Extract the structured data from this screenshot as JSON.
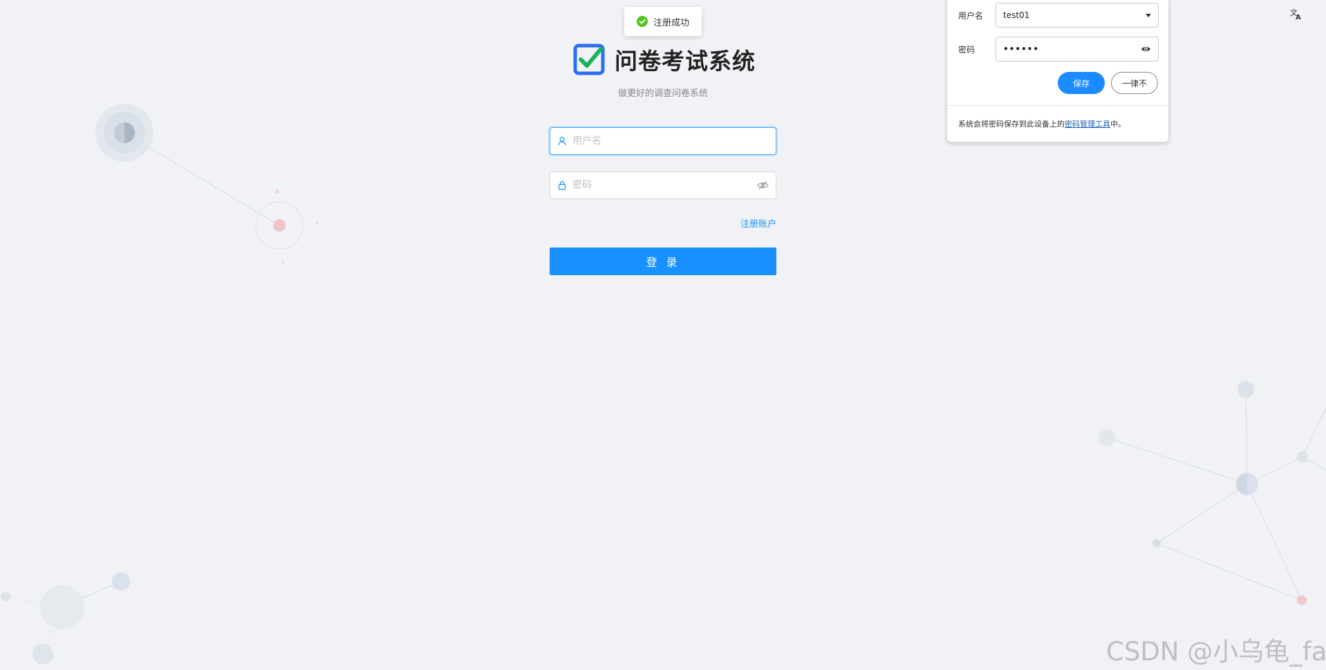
{
  "toast": {
    "text": "注册成功"
  },
  "header": {
    "title": "问卷考试系统",
    "subtitle": "做更好的调查问卷系统"
  },
  "login_form": {
    "username_placeholder": "用户名",
    "password_placeholder": "密码",
    "register_link": "注册账户",
    "login_button": "登 录"
  },
  "password_popup": {
    "username_label": "用户名",
    "username_value": "test01",
    "password_label": "密码",
    "password_value": "••••••",
    "save_button": "保存",
    "never_button": "一律不",
    "footer_prefix": "系统会将密码保存到此设备上的",
    "footer_link": "密码管理工具",
    "footer_suffix": "中。"
  },
  "watermark": "CSDN @小乌龟_far",
  "colors": {
    "primary": "#1890ff",
    "success": "#52c41a",
    "background": "#f0f2f5"
  },
  "icons": [
    "check-circle-icon",
    "logo-checkbox-icon",
    "user-icon",
    "lock-icon",
    "eye-hidden-icon",
    "translate-icon",
    "dropdown-caret-icon",
    "eye-icon"
  ]
}
